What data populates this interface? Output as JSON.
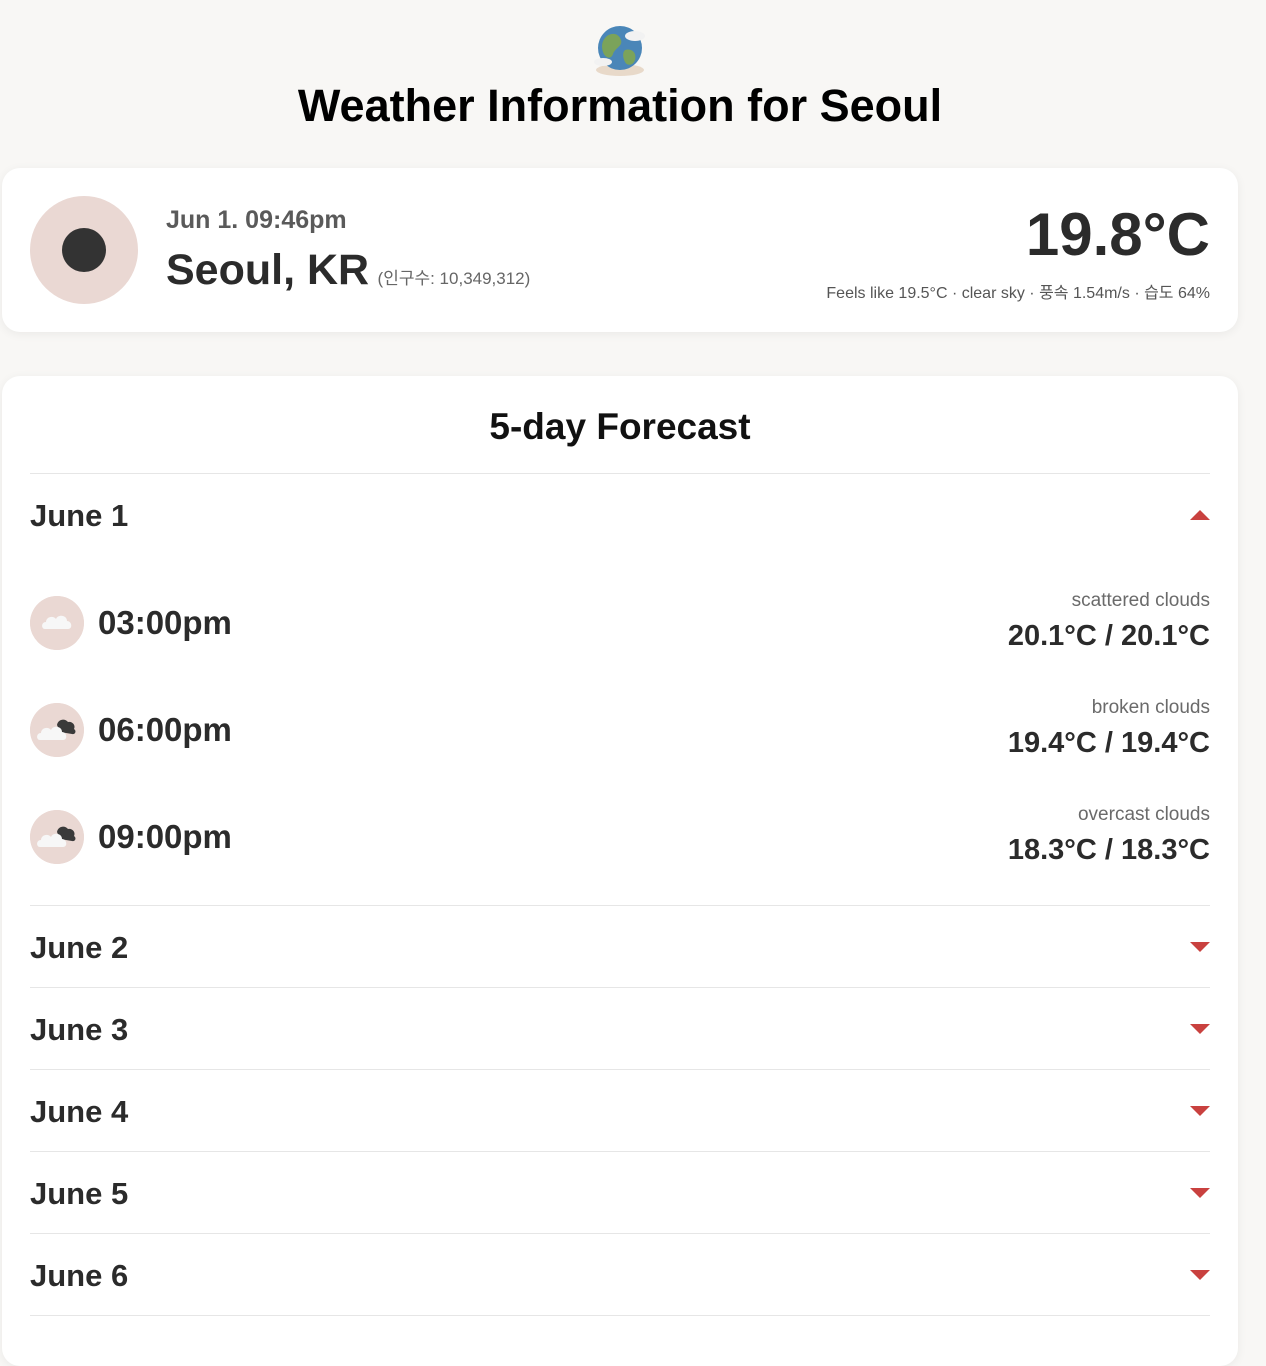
{
  "header": {
    "icon": "globe-icon",
    "title": "Weather Information for Seoul"
  },
  "current": {
    "icon": "moon-icon",
    "datetime": "Jun 1. 09:46pm",
    "city": "Seoul, KR",
    "population": "(인구수: 10,349,312)",
    "temperature": "19.8°C",
    "details": "Feels like 19.5°C · clear sky · 풍속 1.54m/s · 습도 64%"
  },
  "forecast": {
    "title": "5-day Forecast",
    "days": [
      {
        "label": "June 1",
        "expanded": true,
        "hours": [
          {
            "time": "03:00pm",
            "description": "scattered clouds",
            "temp": "20.1°C / 20.1°C",
            "icon": "cloud-icon"
          },
          {
            "time": "06:00pm",
            "description": "broken clouds",
            "temp": "19.4°C / 19.4°C",
            "icon": "broken-clouds-icon"
          },
          {
            "time": "09:00pm",
            "description": "overcast clouds",
            "temp": "18.3°C / 18.3°C",
            "icon": "overcast-clouds-icon"
          }
        ]
      },
      {
        "label": "June 2",
        "expanded": false
      },
      {
        "label": "June 3",
        "expanded": false
      },
      {
        "label": "June 4",
        "expanded": false
      },
      {
        "label": "June 5",
        "expanded": false
      },
      {
        "label": "June 6",
        "expanded": false
      }
    ]
  },
  "colors": {
    "accent": "#c9413f",
    "icon_bg": "#ead8d3",
    "page_bg": "#f8f7f5"
  }
}
